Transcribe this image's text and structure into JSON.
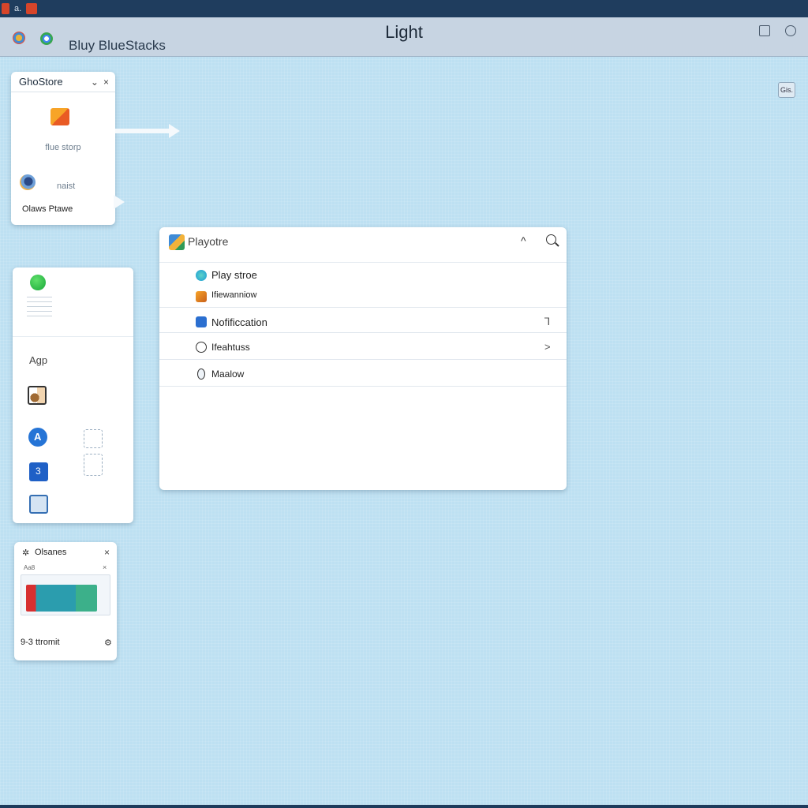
{
  "os_bar": {
    "label": "a."
  },
  "titlebar": {
    "app_name": "Bluy BlueStacks",
    "title": "Light"
  },
  "corner_button": {
    "label": "Gis."
  },
  "store_panel": {
    "title": "GhoStore",
    "close": "×",
    "caret": "⌄",
    "tagline": "flue storp",
    "sub": "naist",
    "footer": "Olaws Ptawe"
  },
  "apps_panel": {
    "label": "Agp"
  },
  "main_window": {
    "title": "Playotre",
    "caret": "^",
    "items": [
      {
        "label": "Play stroe",
        "trail": ""
      },
      {
        "label": "Ifiewanniow",
        "trail": ""
      },
      {
        "label": "Nofificcation",
        "trail": "⅂"
      },
      {
        "label": "Ifeahtuss",
        "trail": ">"
      },
      {
        "label": "Maalow",
        "trail": ""
      }
    ]
  },
  "mini_window": {
    "title": "Olsanes",
    "sub": "Aa8",
    "footer": "9-3 ttromit",
    "close": "×"
  },
  "colors": {
    "desktop": "#bde0f2",
    "titlebar": "#c7d4e2",
    "os_strip": "#1f3d5e"
  }
}
